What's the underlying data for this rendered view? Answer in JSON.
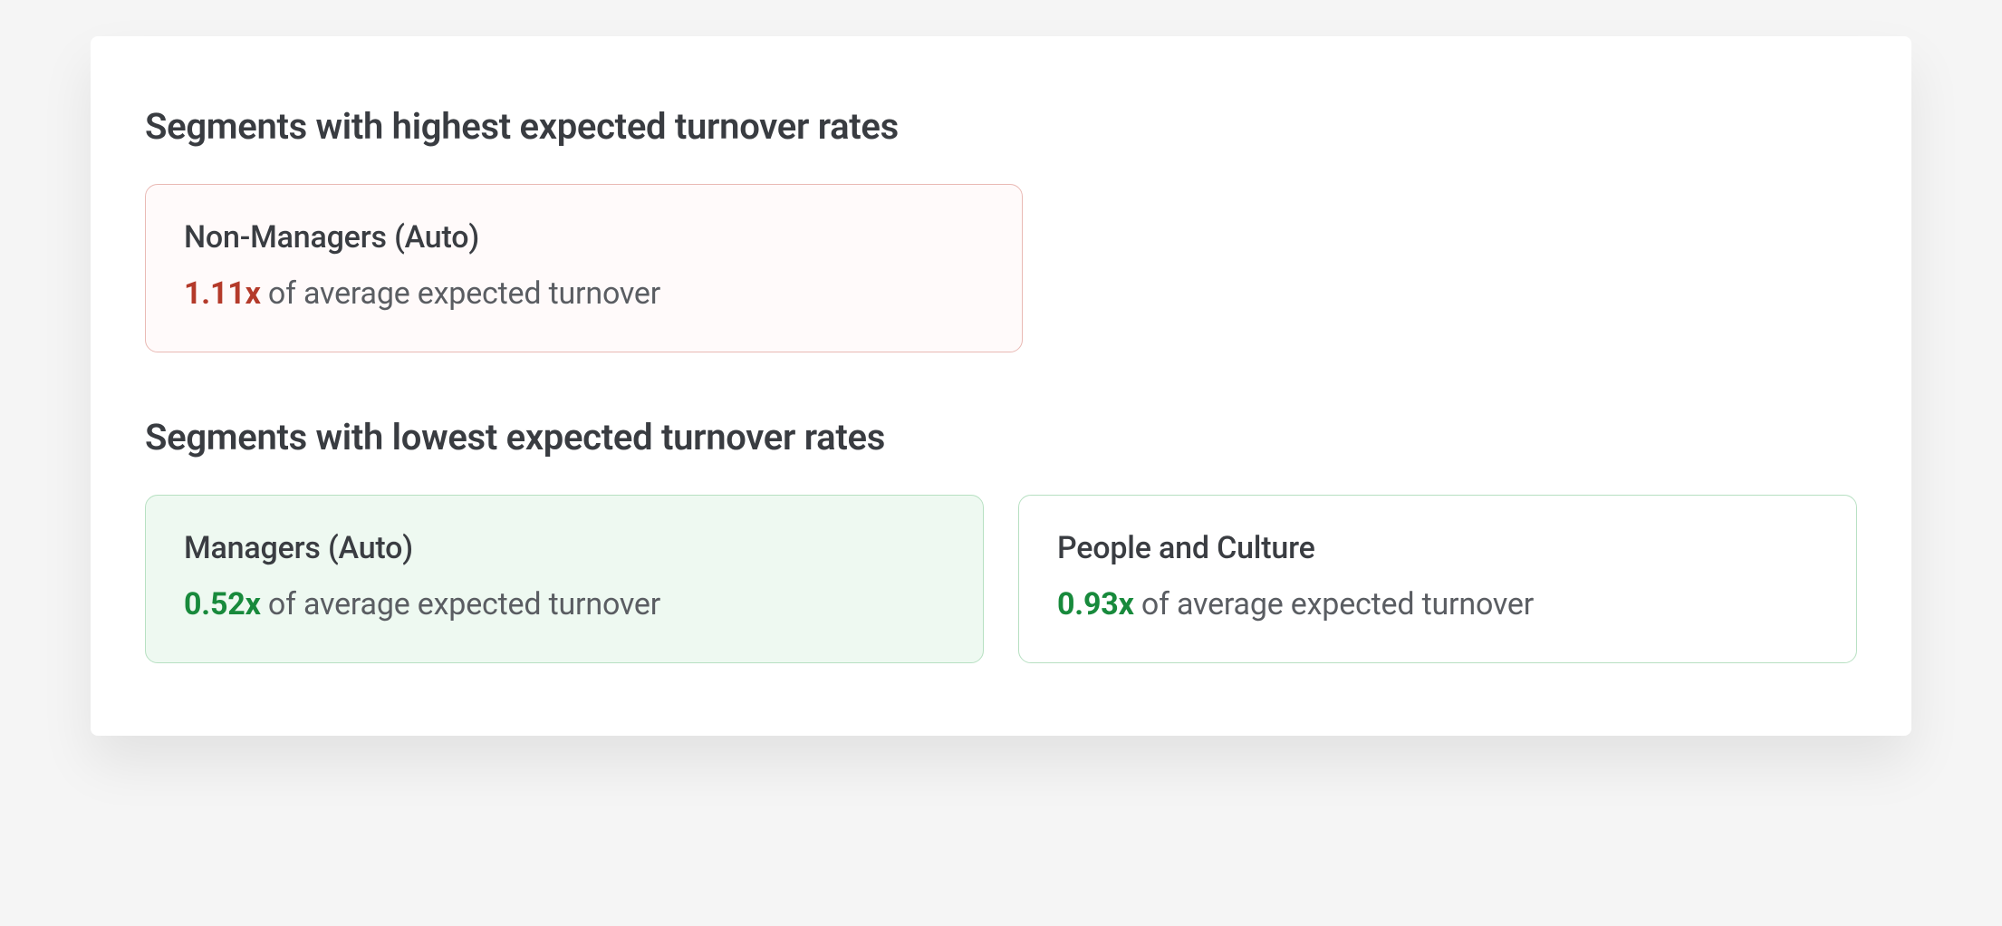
{
  "headings": {
    "highest": "Segments with highest expected turnover rates",
    "lowest": "Segments with lowest expected turnover rates"
  },
  "suffix": " of average expected turnover",
  "highest": [
    {
      "title": "Non-Managers (Auto)",
      "multiplier": "1.11x"
    }
  ],
  "lowest": [
    {
      "title": "Managers (Auto)",
      "multiplier": "0.52x"
    },
    {
      "title": "People and Culture",
      "multiplier": "0.93x"
    }
  ]
}
